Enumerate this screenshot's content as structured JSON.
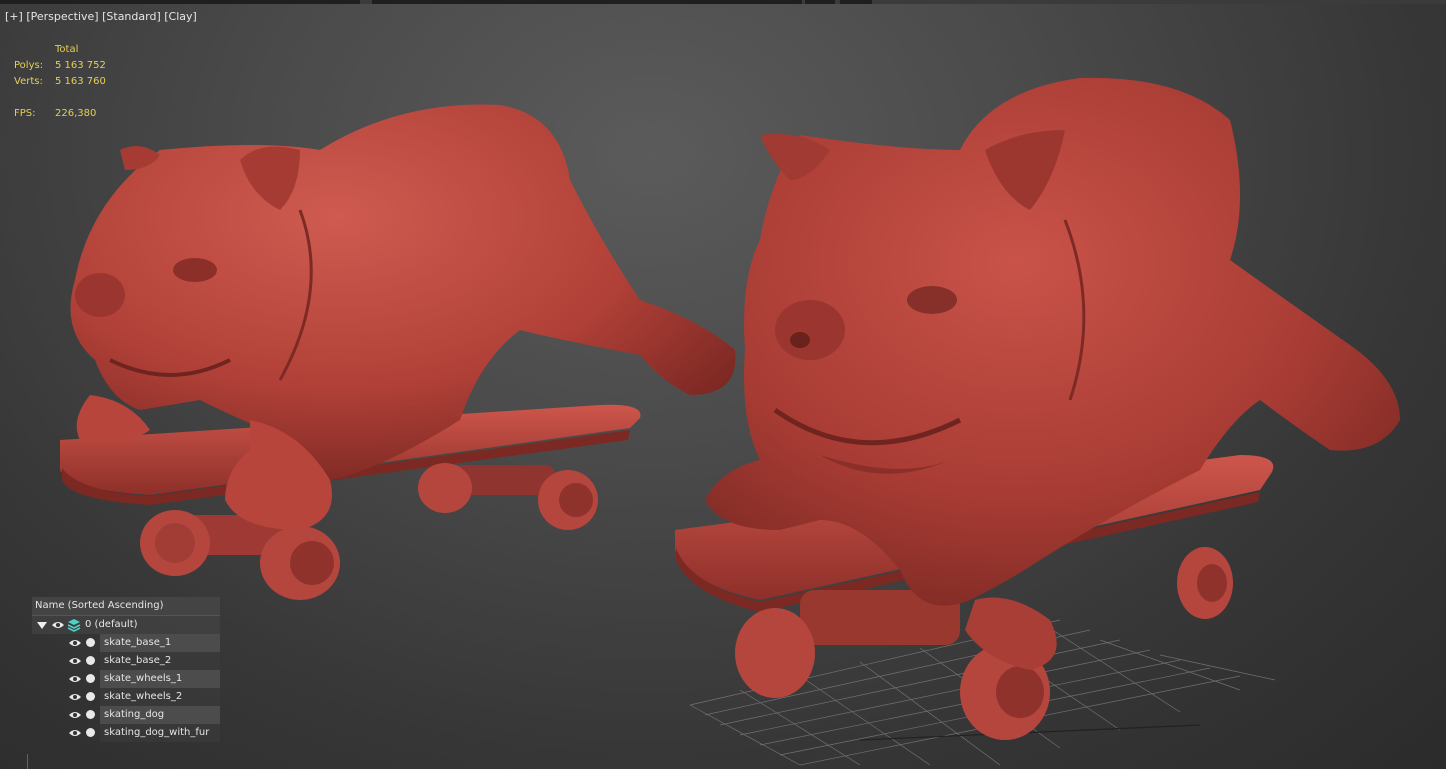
{
  "viewport": {
    "menu_plus": "[+]",
    "menu_view": "[Perspective]",
    "menu_shading": "[Standard]",
    "menu_style": "[Clay]"
  },
  "stats": {
    "header": "Total",
    "polys_label": "Polys:",
    "polys_value": "5 163 752",
    "verts_label": "Verts:",
    "verts_value": "5 163 760",
    "fps_label": "FPS:",
    "fps_value": "226,380",
    "color": "#e6cf53"
  },
  "scene": {
    "model_color": "#b9483f",
    "grid_color": "#8a8a8a"
  },
  "explorer": {
    "header": "Name (Sorted Ascending)",
    "root_label": "0 (default)",
    "items": [
      {
        "label": "skate_base_1"
      },
      {
        "label": "skate_base_2"
      },
      {
        "label": "skate_wheels_1"
      },
      {
        "label": "skate_wheels_2"
      },
      {
        "label": "skating_dog"
      },
      {
        "label": "skating_dog_with_fur"
      }
    ]
  },
  "icons": {
    "expand": "triangle-down-icon",
    "visibility": "eye-icon",
    "layer": "layers-icon",
    "object": "circle-icon"
  }
}
